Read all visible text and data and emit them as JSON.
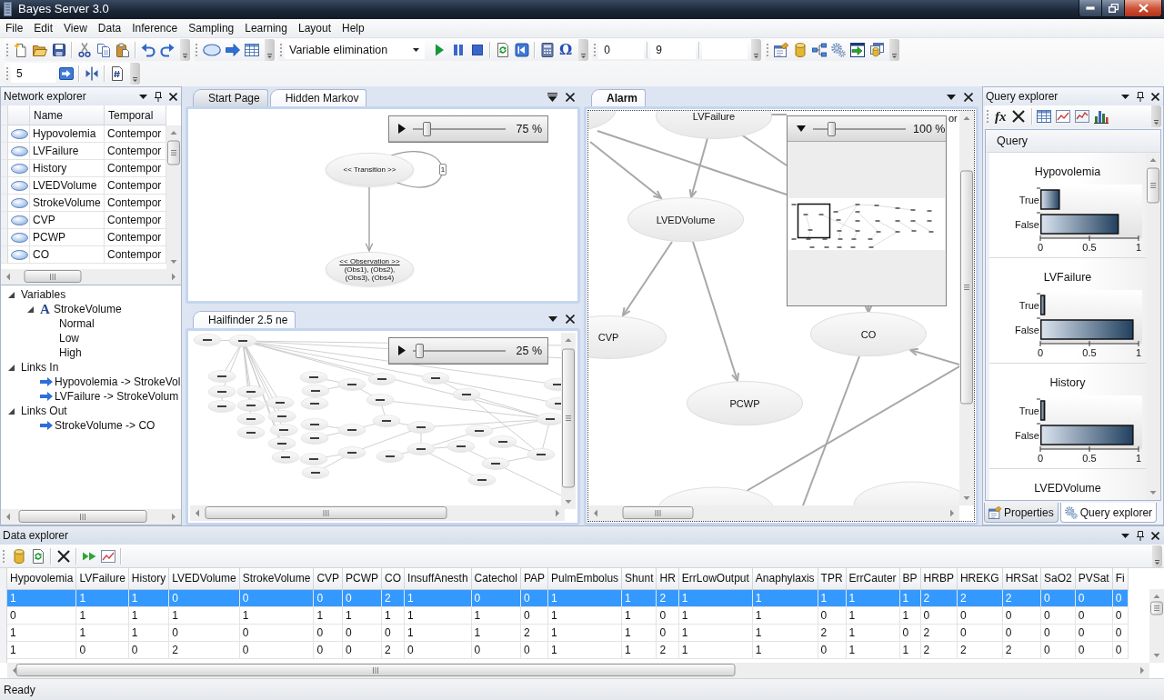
{
  "window": {
    "title": "Bayes Server 3.0"
  },
  "menu": [
    "File",
    "Edit",
    "View",
    "Data",
    "Inference",
    "Sampling",
    "Learning",
    "Layout",
    "Help"
  ],
  "toolbar": {
    "inference_engine": "Variable elimination",
    "symbol": "Ω",
    "fields": [
      "0",
      "9"
    ],
    "row2_field": "5"
  },
  "network_explorer": {
    "title": "Network explorer",
    "columns": [
      "Name",
      "Temporal"
    ],
    "rows": [
      {
        "name": "Hypovolemia",
        "temporal": "Contempor"
      },
      {
        "name": "LVFailure",
        "temporal": "Contempor"
      },
      {
        "name": "History",
        "temporal": "Contempor"
      },
      {
        "name": "LVEDVolume",
        "temporal": "Contempor"
      },
      {
        "name": "StrokeVolume",
        "temporal": "Contempor"
      },
      {
        "name": "CVP",
        "temporal": "Contempor"
      },
      {
        "name": "PCWP",
        "temporal": "Contempor"
      },
      {
        "name": "CO",
        "temporal": "Contempor"
      }
    ],
    "tree": [
      {
        "label": "Variables",
        "expanded": true,
        "children": [
          {
            "kind": "variable",
            "glyph": "A",
            "label": "StrokeVolume",
            "expanded": true,
            "children": [
              {
                "label": "Normal"
              },
              {
                "label": "Low"
              },
              {
                "label": "High"
              }
            ]
          }
        ]
      },
      {
        "label": "Links In",
        "expanded": true,
        "children": [
          {
            "kind": "link",
            "label": "Hypovolemia -> StrokeVol"
          },
          {
            "kind": "link",
            "label": "LVFailure -> StrokeVolum"
          }
        ]
      },
      {
        "label": "Links Out",
        "expanded": true,
        "children": [
          {
            "kind": "link",
            "label": "StrokeVolume -> CO"
          }
        ]
      }
    ]
  },
  "documents": [
    {
      "focused": false,
      "tabs": [
        {
          "label": "Start Page",
          "selected": false
        },
        {
          "label": "Hidden Markov",
          "selected": true
        }
      ],
      "zoom": {
        "expanded": false,
        "level": 0.12,
        "reading": "75 %"
      },
      "diagram": {
        "kind": "dbn",
        "nodes": [
          {
            "title": "<< Transition >>"
          },
          {
            "title": "<< Observation >>",
            "lines": [
              "(Obs1), (Obs2),",
              "(Obs3), (Obs4)"
            ]
          }
        ],
        "loop_label": "1"
      }
    },
    {
      "focused": false,
      "tabs": [
        {
          "label": "Hailfinder 2.5 ne",
          "selected": true
        }
      ],
      "zoom": {
        "expanded": false,
        "level": 0.03,
        "reading": "25 %"
      },
      "diagram": {
        "kind": "miniature"
      }
    },
    {
      "focused": true,
      "tabs": [
        {
          "label": "Alarm",
          "selected": true
        }
      ],
      "zoom": {
        "expanded": true,
        "level": 0.17,
        "reading": "100 %"
      },
      "diagram": {
        "kind": "network",
        "nodes": [
          {
            "label": "LVFailure"
          },
          {
            "label": "LVEDVolume"
          },
          {
            "label": "CVP"
          },
          {
            "label": "PCWP"
          },
          {
            "label": "CO"
          },
          {
            "label": "or"
          }
        ]
      }
    }
  ],
  "query_explorer": {
    "title": "Query explorer",
    "formula_symbol": "fx",
    "column": "Query",
    "queries": [
      {
        "title": "Hypovolemia",
        "chart_data": {
          "type": "bar",
          "orientation": "horizontal",
          "categories": [
            "True",
            "False"
          ],
          "values": [
            0.2,
            0.8
          ],
          "xlim": [
            0,
            1
          ],
          "xticks": [
            0,
            0.5,
            1
          ]
        }
      },
      {
        "title": "LVFailure",
        "chart_data": {
          "type": "bar",
          "orientation": "horizontal",
          "categories": [
            "True",
            "False"
          ],
          "values": [
            0.05,
            0.95
          ],
          "xlim": [
            0,
            1
          ],
          "xticks": [
            0,
            0.5,
            1
          ]
        }
      },
      {
        "title": "History",
        "chart_data": {
          "type": "bar",
          "orientation": "horizontal",
          "categories": [
            "True",
            "False"
          ],
          "values": [
            0.05,
            0.95
          ],
          "xlim": [
            0,
            1
          ],
          "xticks": [
            0,
            0.5,
            1
          ]
        }
      },
      {
        "title": "LVEDVolume"
      }
    ],
    "tabs": [
      {
        "label": "Properties",
        "selected": false
      },
      {
        "label": "Query explorer",
        "selected": true
      }
    ]
  },
  "data_explorer": {
    "title": "Data explorer",
    "columns": [
      "Hypovolemia",
      "LVFailure",
      "History",
      "LVEDVolume",
      "StrokeVolume",
      "CVP",
      "PCWP",
      "CO",
      "InsuffAnesth",
      "Catechol",
      "PAP",
      "PulmEmbolus",
      "Shunt",
      "HR",
      "ErrLowOutput",
      "Anaphylaxis",
      "TPR",
      "ErrCauter",
      "BP",
      "HRBP",
      "HREKG",
      "HRSat",
      "SaO2",
      "PVSat",
      "Fi"
    ],
    "rows": [
      {
        "selected": true,
        "cells": [
          "1",
          "1",
          "1",
          "0",
          "0",
          "0",
          "0",
          "2",
          "1",
          "0",
          "0",
          "1",
          "1",
          "2",
          "1",
          "1",
          "1",
          "1",
          "1",
          "2",
          "2",
          "2",
          "0",
          "0",
          "0"
        ]
      },
      {
        "selected": false,
        "cells": [
          "0",
          "1",
          "1",
          "1",
          "1",
          "1",
          "1",
          "1",
          "1",
          "1",
          "0",
          "1",
          "1",
          "0",
          "1",
          "1",
          "0",
          "1",
          "1",
          "0",
          "0",
          "0",
          "0",
          "0",
          "0"
        ]
      },
      {
        "selected": false,
        "cells": [
          "1",
          "1",
          "1",
          "0",
          "0",
          "0",
          "0",
          "0",
          "1",
          "1",
          "2",
          "1",
          "1",
          "0",
          "1",
          "1",
          "2",
          "1",
          "0",
          "2",
          "0",
          "0",
          "0",
          "0",
          "0"
        ]
      },
      {
        "selected": false,
        "cells": [
          "1",
          "0",
          "0",
          "2",
          "0",
          "0",
          "0",
          "2",
          "0",
          "0",
          "0",
          "1",
          "1",
          "2",
          "1",
          "1",
          "0",
          "1",
          "1",
          "2",
          "2",
          "2",
          "0",
          "0",
          "0"
        ]
      }
    ]
  },
  "status_bar": "Ready"
}
